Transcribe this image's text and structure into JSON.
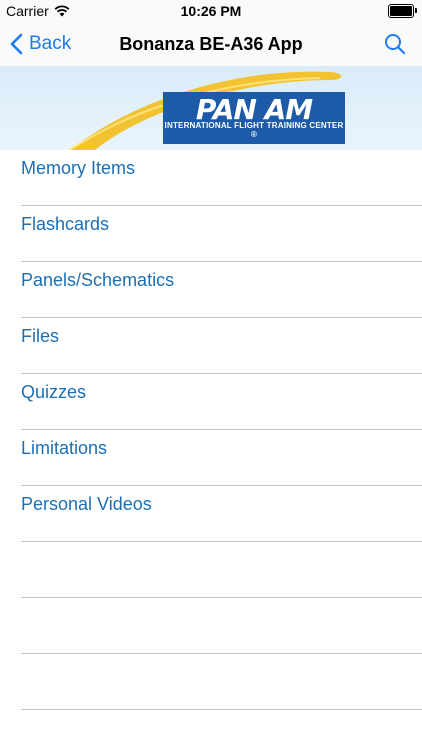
{
  "status_bar": {
    "carrier": "Carrier",
    "time": "10:26 PM"
  },
  "nav": {
    "back_label": "Back",
    "title": "Bonanza BE-A36 App"
  },
  "banner": {
    "logo_main": "PAN AM",
    "logo_sub": "INTERNATIONAL FLIGHT TRAINING CENTER ®"
  },
  "menu": {
    "items": [
      {
        "label": "Memory Items"
      },
      {
        "label": "Flashcards"
      },
      {
        "label": "Panels/Schematics"
      },
      {
        "label": "Files"
      },
      {
        "label": "Quizzes"
      },
      {
        "label": "Limitations"
      },
      {
        "label": "Personal Videos"
      }
    ]
  },
  "colors": {
    "accent": "#1a7cf0",
    "list_text": "#1d6fb1",
    "logo_blue": "#1d5aa8",
    "swoosh": "#f2c230"
  }
}
